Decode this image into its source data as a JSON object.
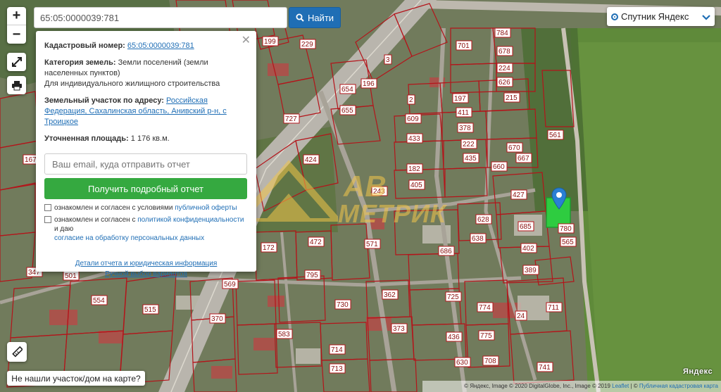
{
  "search": {
    "value": "65:05:0000039:781",
    "button_label": "Найти"
  },
  "layer_select": {
    "selected": "Спутник Яндекс"
  },
  "info_panel": {
    "cadastral_label": "Кадастровый номер:",
    "cadastral_value": "65:05:0000039:781",
    "category_label": "Категория земель:",
    "category_value": "Земли поселений (земли населенных пунктов)",
    "usage": "Для индивидуального жилищного строительства",
    "address_label": "Земельный участок по адресу:",
    "address_value": "Российская Федерация, Сахалинская область, Анивский р-н, с Троицкое",
    "area_label": "Уточненная площадь:",
    "area_value": "1 176 кв.м.",
    "email_placeholder": "Ваш email, куда отправить отчет",
    "report_button": "Получить подробный отчет",
    "consent1_text": "ознакомлен и согласен с условиями",
    "consent1_link": "публичной оферты",
    "consent2_text": "ознакомлен и согласен с",
    "consent2_link": "политикой конфиденциальности",
    "consent2_tail": "и даю",
    "consent2_line2": "согласие на обработку персональных данных",
    "details_link": "Детали отчета и юридическая информация",
    "manual_link": "Ручной выбор вариантов"
  },
  "not_found_button": "Не нашли участок/дом на карте?",
  "yandex_logo": "Яндекс",
  "attribution": {
    "text": "© Яндекс, Image © 2020 DigitalGlobe, Inc., Image © 2019",
    "leaflet": "Leaflet",
    "sep": " | © ",
    "public_map": "Публичная кадастровая карта"
  },
  "watermark": {
    "line1": "АВ",
    "line2": "МЕТРИК"
  },
  "plot_labels": [
    "229",
    "199",
    "196",
    "654",
    "655",
    "727",
    "784",
    "678",
    "701",
    "224",
    "626",
    "215",
    "197",
    "411",
    "378",
    "609",
    "433",
    "222",
    "670",
    "667",
    "435",
    "660",
    "424",
    "182",
    "405",
    "243",
    "427",
    "685",
    "780",
    "565",
    "402",
    "389",
    "686",
    "638",
    "628",
    "725",
    "362",
    "373",
    "436",
    "775",
    "714",
    "713",
    "774",
    "630",
    "708",
    "741",
    "711",
    "24",
    "515",
    "370",
    "569",
    "554",
    "501",
    "347",
    "167",
    "172",
    "472",
    "571",
    "795",
    "730",
    "583",
    "561",
    "2",
    "3"
  ],
  "colors": {
    "accent": "#1f6eb5",
    "green": "#35a940",
    "plot_stroke": "#b4141a",
    "selected_plot": "#2ecc40"
  }
}
